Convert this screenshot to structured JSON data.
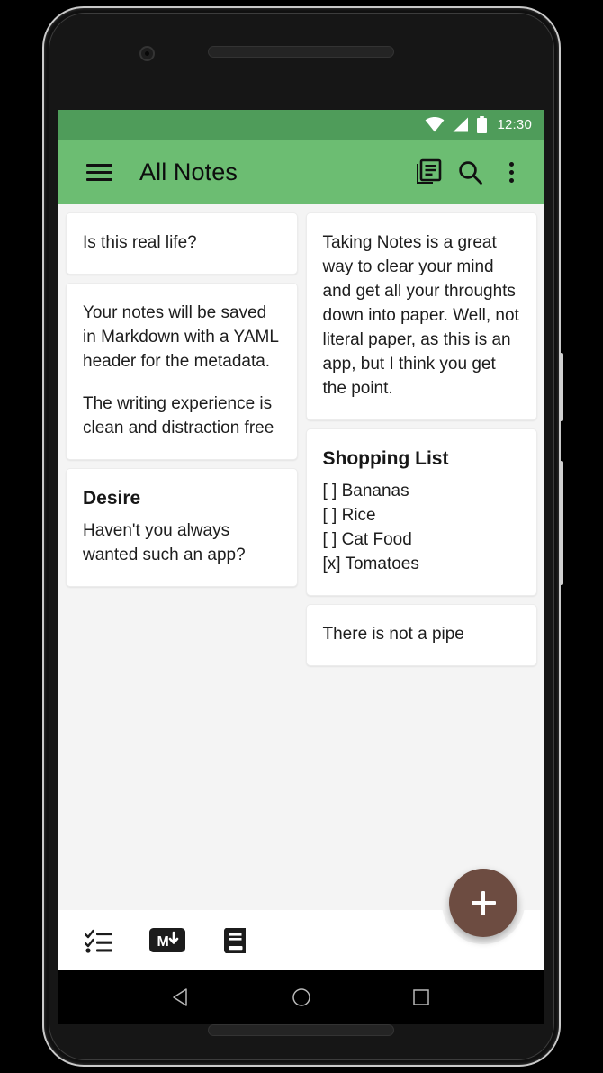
{
  "status_bar": {
    "time": "12:30",
    "icons": [
      "wifi-icon",
      "cellular-signal-icon",
      "battery-icon"
    ],
    "background_color": "#4f9c5a"
  },
  "app_bar": {
    "title": "All Notes",
    "menu_icon": "hamburger-menu-icon",
    "actions": [
      "library-icon",
      "search-icon",
      "overflow-menu-icon"
    ],
    "background_color": "#6cbd72"
  },
  "notes": {
    "left_column": [
      {
        "title": "",
        "paragraphs": [
          "Is this real life?"
        ]
      },
      {
        "title": "",
        "paragraphs": [
          "Your notes will be saved in Markdown with a YAML header for the metadata.",
          "The writing experience is clean and distraction free"
        ]
      },
      {
        "title": "Desire",
        "paragraphs": [
          "Haven't you always wanted such an app?"
        ]
      }
    ],
    "right_column": [
      {
        "title": "",
        "paragraphs": [
          "Taking Notes is a great way to clear your mind and get all your throughts down into paper. Well, not literal paper, as this is an app, but I think you get the point."
        ]
      },
      {
        "title": "Shopping List",
        "paragraphs": [
          "[ ] Bananas\n[ ] Rice\n[ ] Cat Food\n[x] Tomatoes"
        ]
      },
      {
        "title": "",
        "paragraphs": [
          "There is not a pipe"
        ]
      }
    ]
  },
  "bottom_bar": {
    "actions": [
      "checklist-icon",
      "markdown-icon",
      "notebook-icon"
    ],
    "markdown_label": "M",
    "fab": {
      "icon": "plus-icon",
      "color": "#6d4c41"
    }
  },
  "navigation_bar": {
    "buttons": [
      "back-button",
      "home-button",
      "recents-button"
    ]
  }
}
